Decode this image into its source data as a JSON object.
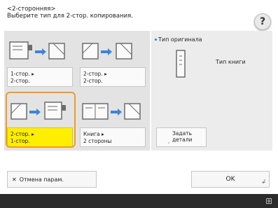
{
  "header": {
    "title": "<2-сторонняя>",
    "subtitle": "Выберите тип для 2-стор. копирования."
  },
  "help": {
    "label": "?"
  },
  "options": [
    {
      "label_line1": "1-стор. ▸",
      "label_line2": "2-стор."
    },
    {
      "label_line1": "2-стор. ▸",
      "label_line2": "2-стор."
    },
    {
      "label_line1": "2-стор. ▸",
      "label_line2": "1-стор."
    },
    {
      "label_line1": "Книга ▸",
      "label_line2": "2 стороны"
    }
  ],
  "original": {
    "title": "Тип оригинала",
    "book_type": "Тип книги"
  },
  "details": {
    "line1": "Задать",
    "line2": "детали",
    "corner": ","
  },
  "footer": {
    "cancel_label": "Отмена парам.",
    "ok_label": "OK",
    "ok_corner": "↲"
  },
  "colors": {
    "selected": "#ffee00",
    "frame": "#f09a2a",
    "status_bar": "#2b2b2b"
  }
}
